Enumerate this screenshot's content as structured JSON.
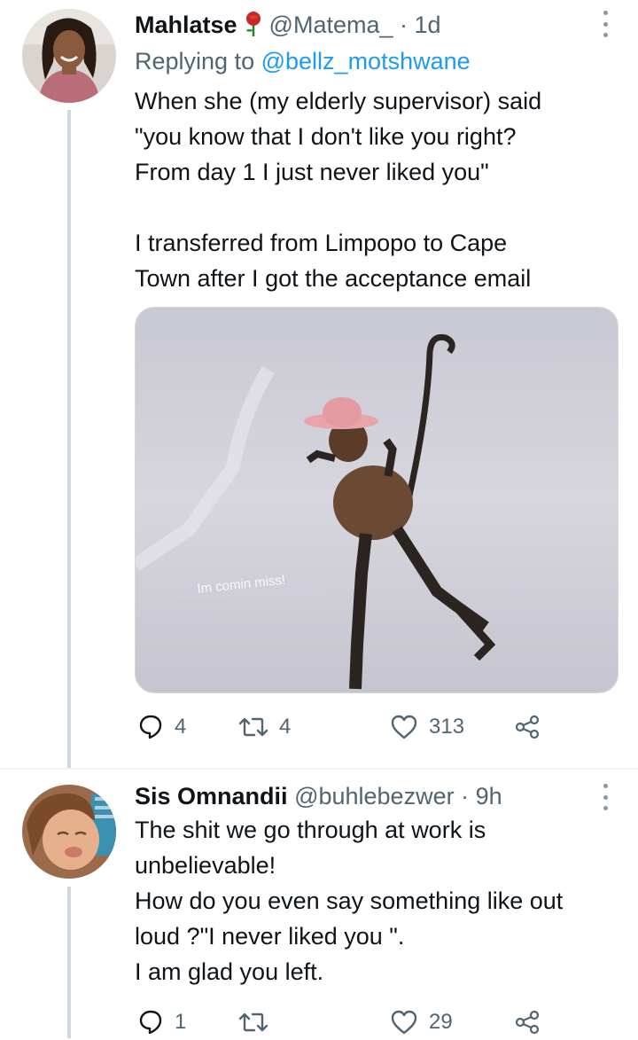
{
  "tweets": [
    {
      "name": "Mahlatse",
      "handle": "@Matema_",
      "time": "· 1d",
      "replying_prefix": "Replying to",
      "replying_to": "@bellz_motshwane",
      "lines_a": [
        "When she (my elderly supervisor) said",
        "\"you know that I don't like you right?",
        "From day 1 I just never liked you\""
      ],
      "lines_b": [
        "I transferred from Limpopo to Cape",
        "Town after I got the acceptance email"
      ],
      "media_caption": "Im comin miss!",
      "reply_count": "4",
      "retweet_count": "4",
      "like_count": "313"
    },
    {
      "name": "Sis Omnandii",
      "handle": "@buhlebezwer",
      "time": "· 9h",
      "lines": [
        "The shit we go through at work is",
        "unbelievable!",
        "How do you even say something like out",
        "loud ?\"I never liked you \".",
        "I am glad you left."
      ],
      "reply_count": "1",
      "retweet_count": "",
      "like_count": "29"
    }
  ],
  "colors": {
    "text": "#0f1419",
    "secondary": "#536471",
    "link": "#1d9bf0",
    "thread_line": "#cfd9de"
  },
  "icons": [
    "rose-icon",
    "more-icon",
    "reply-icon",
    "retweet-icon",
    "like-icon",
    "share-icon"
  ]
}
